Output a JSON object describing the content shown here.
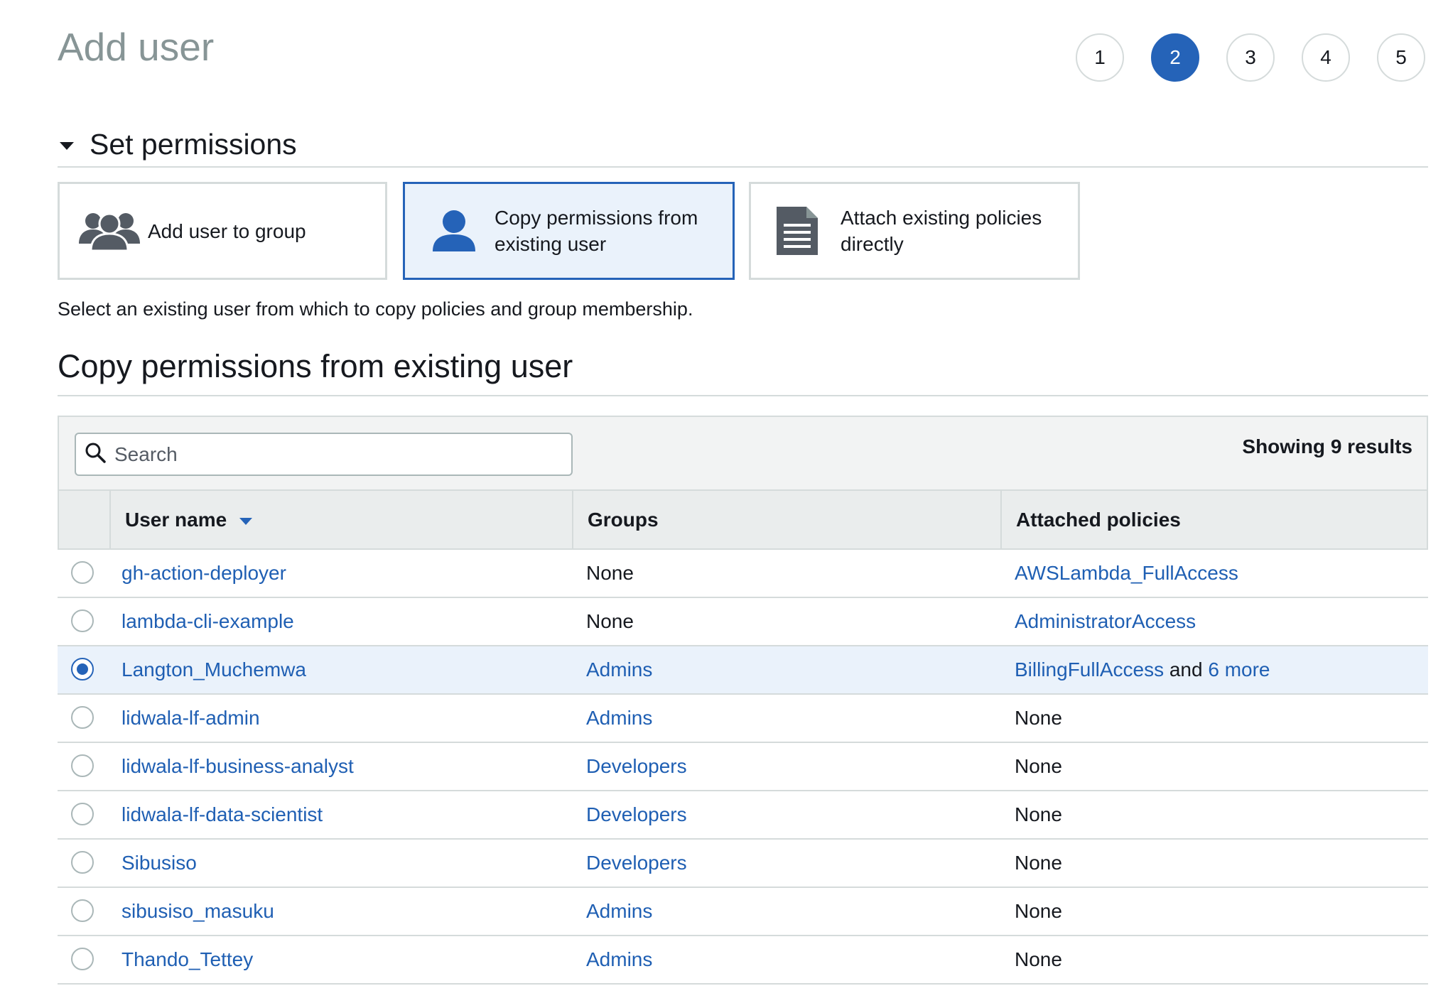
{
  "page": {
    "title": "Add user"
  },
  "steps": [
    {
      "label": "1",
      "active": false
    },
    {
      "label": "2",
      "active": true
    },
    {
      "label": "3",
      "active": false
    },
    {
      "label": "4",
      "active": false
    },
    {
      "label": "5",
      "active": false
    }
  ],
  "section": {
    "title": "Set permissions"
  },
  "options": [
    {
      "label": "Add user to group",
      "icon": "user-group-icon",
      "selected": false
    },
    {
      "label_line1": "Copy permissions from",
      "label_line2": "existing user",
      "icon": "user-icon",
      "selected": true
    },
    {
      "label_line1": "Attach existing policies",
      "label_line2": "directly",
      "icon": "document-icon",
      "selected": false
    }
  ],
  "help_text": "Select an existing user from which to copy policies and group membership.",
  "subheading": "Copy permissions from existing user",
  "table": {
    "search_placeholder": "Search",
    "results_label": "Showing 9 results",
    "columns": {
      "user_name": "User name",
      "groups": "Groups",
      "policies": "Attached policies"
    },
    "rows": [
      {
        "user": "gh-action-deployer",
        "group": "None",
        "policy": "AWSLambda_FullAccess",
        "selected": false
      },
      {
        "user": "lambda-cli-example",
        "group": "None",
        "policy": "AdministratorAccess",
        "selected": false
      },
      {
        "user": "Langton_Muchemwa",
        "group": "Admins",
        "policy": "BillingFullAccess",
        "policy_and": "and",
        "policy_more": "6 more",
        "selected": true
      },
      {
        "user": "lidwala-lf-admin",
        "group": "Admins",
        "policy": "None",
        "selected": false
      },
      {
        "user": "lidwala-lf-business-analyst",
        "group": "Developers",
        "policy": "None",
        "selected": false
      },
      {
        "user": "lidwala-lf-data-scientist",
        "group": "Developers",
        "policy": "None",
        "selected": false
      },
      {
        "user": "Sibusiso",
        "group": "Developers",
        "policy": "None",
        "selected": false
      },
      {
        "user": "sibusiso_masuku",
        "group": "Admins",
        "policy": "None",
        "selected": false
      },
      {
        "user": "Thando_Tettey",
        "group": "Admins",
        "policy": "None",
        "selected": false
      }
    ]
  },
  "colors": {
    "accent": "#2563b8",
    "link": "#1f5fb3",
    "selected_bg": "#eaf2fb",
    "border": "#d5dbdb"
  }
}
